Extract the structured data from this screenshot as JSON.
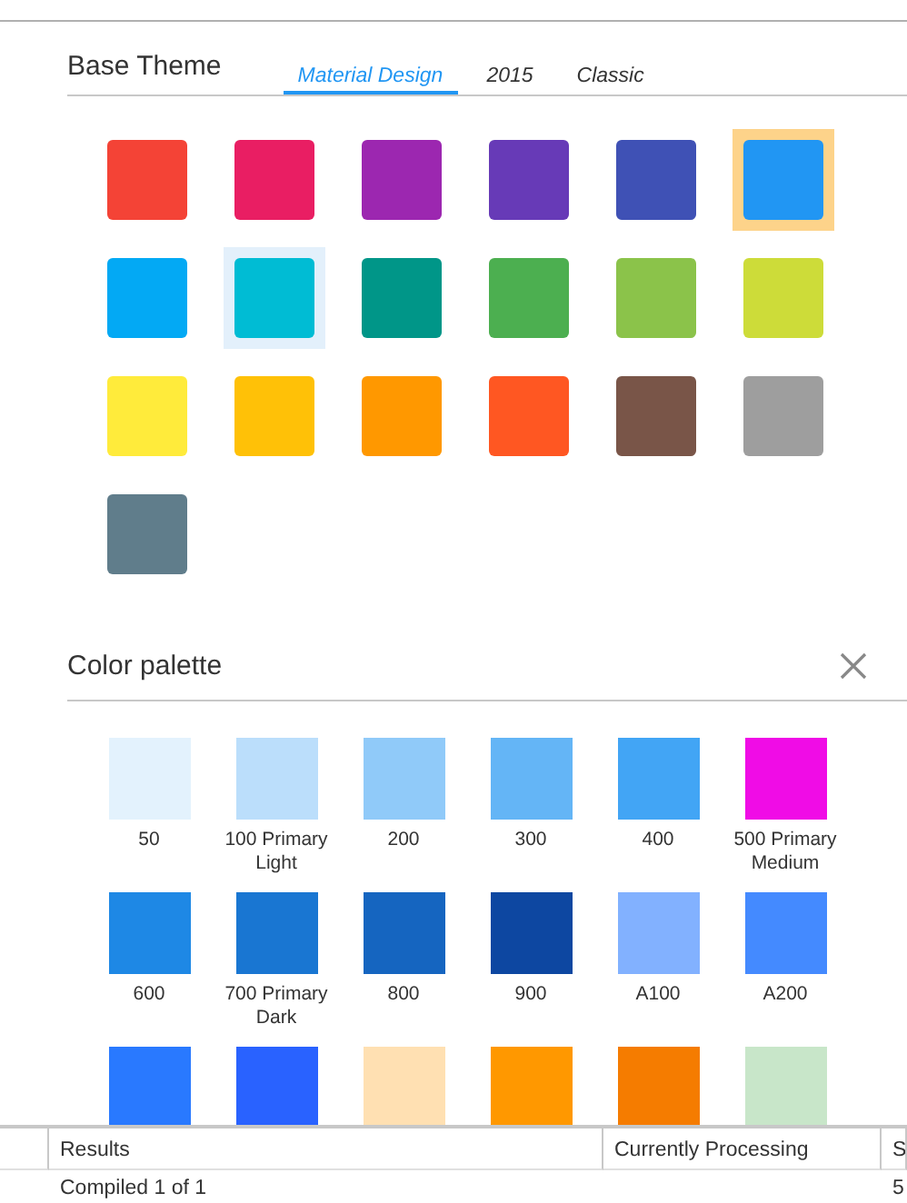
{
  "base_theme": {
    "title": "Base Theme",
    "tabs": [
      {
        "label": "Material Design",
        "selected": true
      },
      {
        "label": "2015",
        "selected": false
      },
      {
        "label": "Classic",
        "selected": false
      }
    ],
    "swatches": [
      {
        "color": "#f44336",
        "selected": false,
        "hovered": false
      },
      {
        "color": "#e91e63",
        "selected": false,
        "hovered": false
      },
      {
        "color": "#9c27b0",
        "selected": false,
        "hovered": false
      },
      {
        "color": "#673ab7",
        "selected": false,
        "hovered": false
      },
      {
        "color": "#3f51b5",
        "selected": false,
        "hovered": false
      },
      {
        "color": "#2196f3",
        "selected": true,
        "hovered": false
      },
      {
        "color": "#03a9f4",
        "selected": false,
        "hovered": false
      },
      {
        "color": "#00bcd4",
        "selected": false,
        "hovered": true
      },
      {
        "color": "#009688",
        "selected": false,
        "hovered": false
      },
      {
        "color": "#4caf50",
        "selected": false,
        "hovered": false
      },
      {
        "color": "#8bc34a",
        "selected": false,
        "hovered": false
      },
      {
        "color": "#cddc39",
        "selected": false,
        "hovered": false
      },
      {
        "color": "#ffeb3b",
        "selected": false,
        "hovered": false
      },
      {
        "color": "#ffc107",
        "selected": false,
        "hovered": false
      },
      {
        "color": "#ff9800",
        "selected": false,
        "hovered": false
      },
      {
        "color": "#ff5722",
        "selected": false,
        "hovered": false
      },
      {
        "color": "#795548",
        "selected": false,
        "hovered": false
      },
      {
        "color": "#9e9e9e",
        "selected": false,
        "hovered": false
      },
      {
        "color": "#607d8b",
        "selected": false,
        "hovered": false
      }
    ]
  },
  "color_palette": {
    "title": "Color palette",
    "swatches": [
      {
        "color": "#e3f2fd",
        "label": "50"
      },
      {
        "color": "#bbdefb",
        "label": "100 Primary Light"
      },
      {
        "color": "#90caf9",
        "label": "200"
      },
      {
        "color": "#64b5f6",
        "label": "300"
      },
      {
        "color": "#42a5f5",
        "label": "400"
      },
      {
        "color": "#f00ce6",
        "label": "500 Primary Medium"
      },
      {
        "color": "#1e88e5",
        "label": "600"
      },
      {
        "color": "#1976d2",
        "label": "700 Primary Dark"
      },
      {
        "color": "#1565c0",
        "label": "800"
      },
      {
        "color": "#0d47a1",
        "label": "900"
      },
      {
        "color": "#82b1ff",
        "label": "A100"
      },
      {
        "color": "#448aff",
        "label": "A200"
      },
      {
        "color": "#2979ff"
      },
      {
        "color": "#2962ff"
      },
      {
        "color": "#ffe0b2"
      },
      {
        "color": "#ff9800"
      },
      {
        "color": "#f57c00"
      },
      {
        "color": "#c8e6c9"
      }
    ]
  },
  "results_table": {
    "columns": [
      "Results",
      "Currently Processing",
      "S"
    ],
    "rows": [
      {
        "results": "Compiled 1 of 1",
        "column_3": "5"
      }
    ]
  }
}
